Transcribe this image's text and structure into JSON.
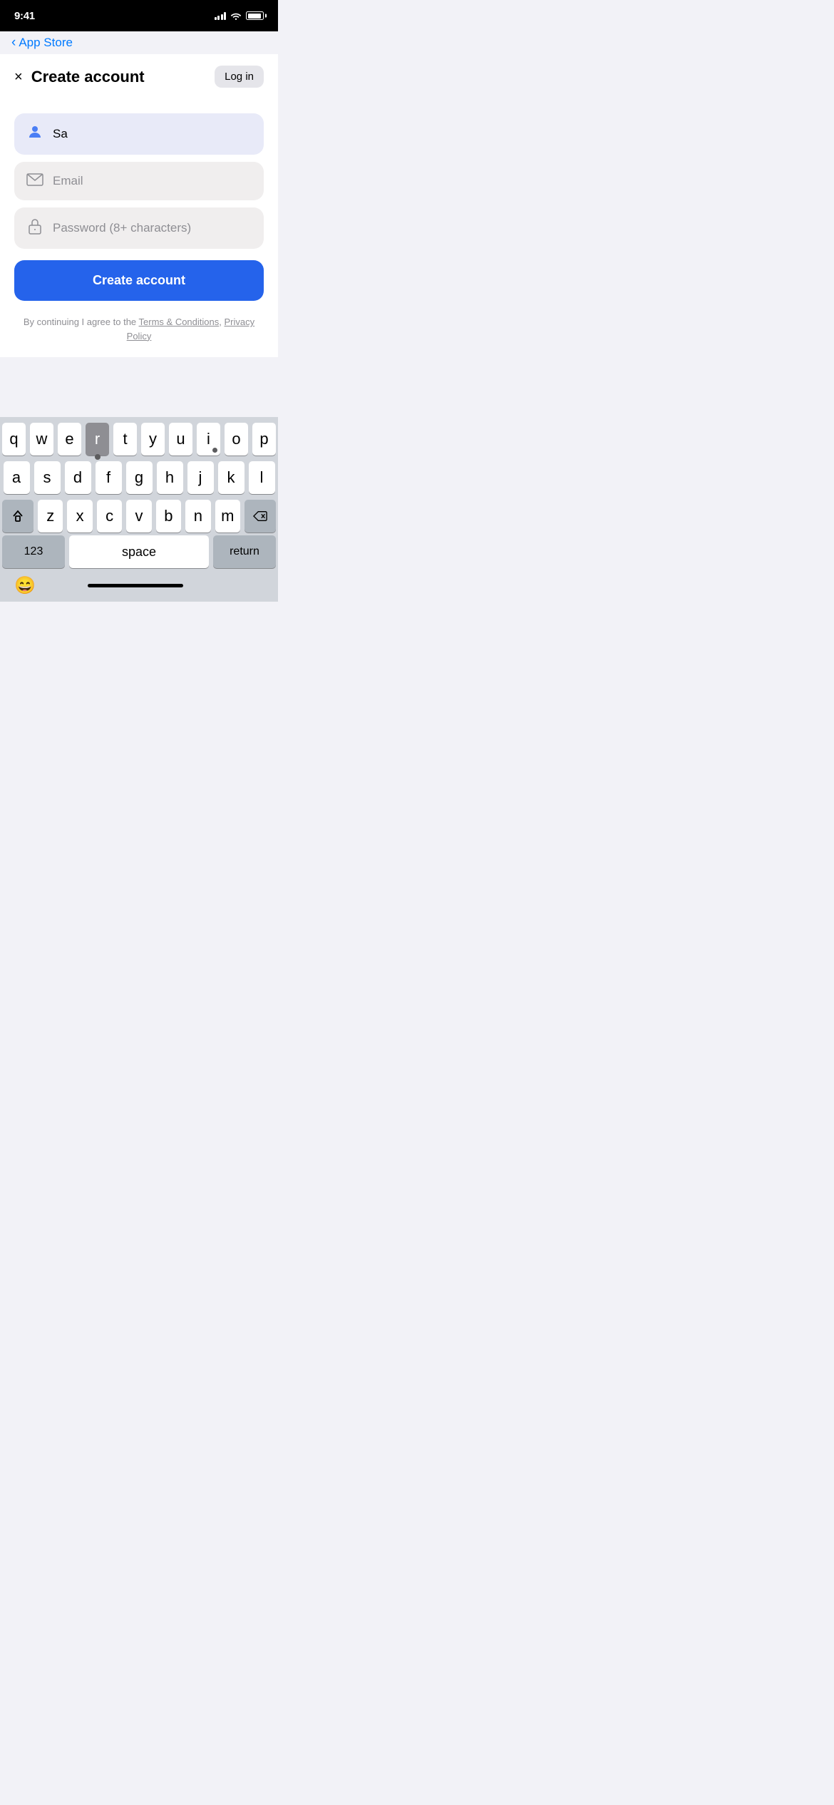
{
  "statusBar": {
    "time": "9:41",
    "batteryLevel": 90
  },
  "navBack": {
    "label": "App Store"
  },
  "header": {
    "title": "Create account",
    "closeLabel": "×",
    "loginLabel": "Log in"
  },
  "form": {
    "nameField": {
      "value": "Sa",
      "placeholder": ""
    },
    "emailField": {
      "value": "",
      "placeholder": "Email"
    },
    "passwordField": {
      "value": "",
      "placeholder": "Password (8+ characters)"
    },
    "createButtonLabel": "Create account"
  },
  "terms": {
    "prefix": "By continuing I agree to the ",
    "termsLabel": "Terms & Conditions",
    "separator": ", ",
    "privacyLabel": "Privacy Policy"
  },
  "keyboard": {
    "row1": [
      "q",
      "w",
      "e",
      "r",
      "t",
      "y",
      "u",
      "i",
      "o",
      "p"
    ],
    "row2": [
      "a",
      "s",
      "d",
      "f",
      "g",
      "h",
      "j",
      "k",
      "l"
    ],
    "row3": [
      "z",
      "x",
      "c",
      "v",
      "b",
      "n",
      "m"
    ],
    "spaceLabel": "space",
    "returnLabel": "return",
    "numbersLabel": "123",
    "activeKey": "r",
    "cursorKey": "i"
  },
  "homeIndicator": {}
}
